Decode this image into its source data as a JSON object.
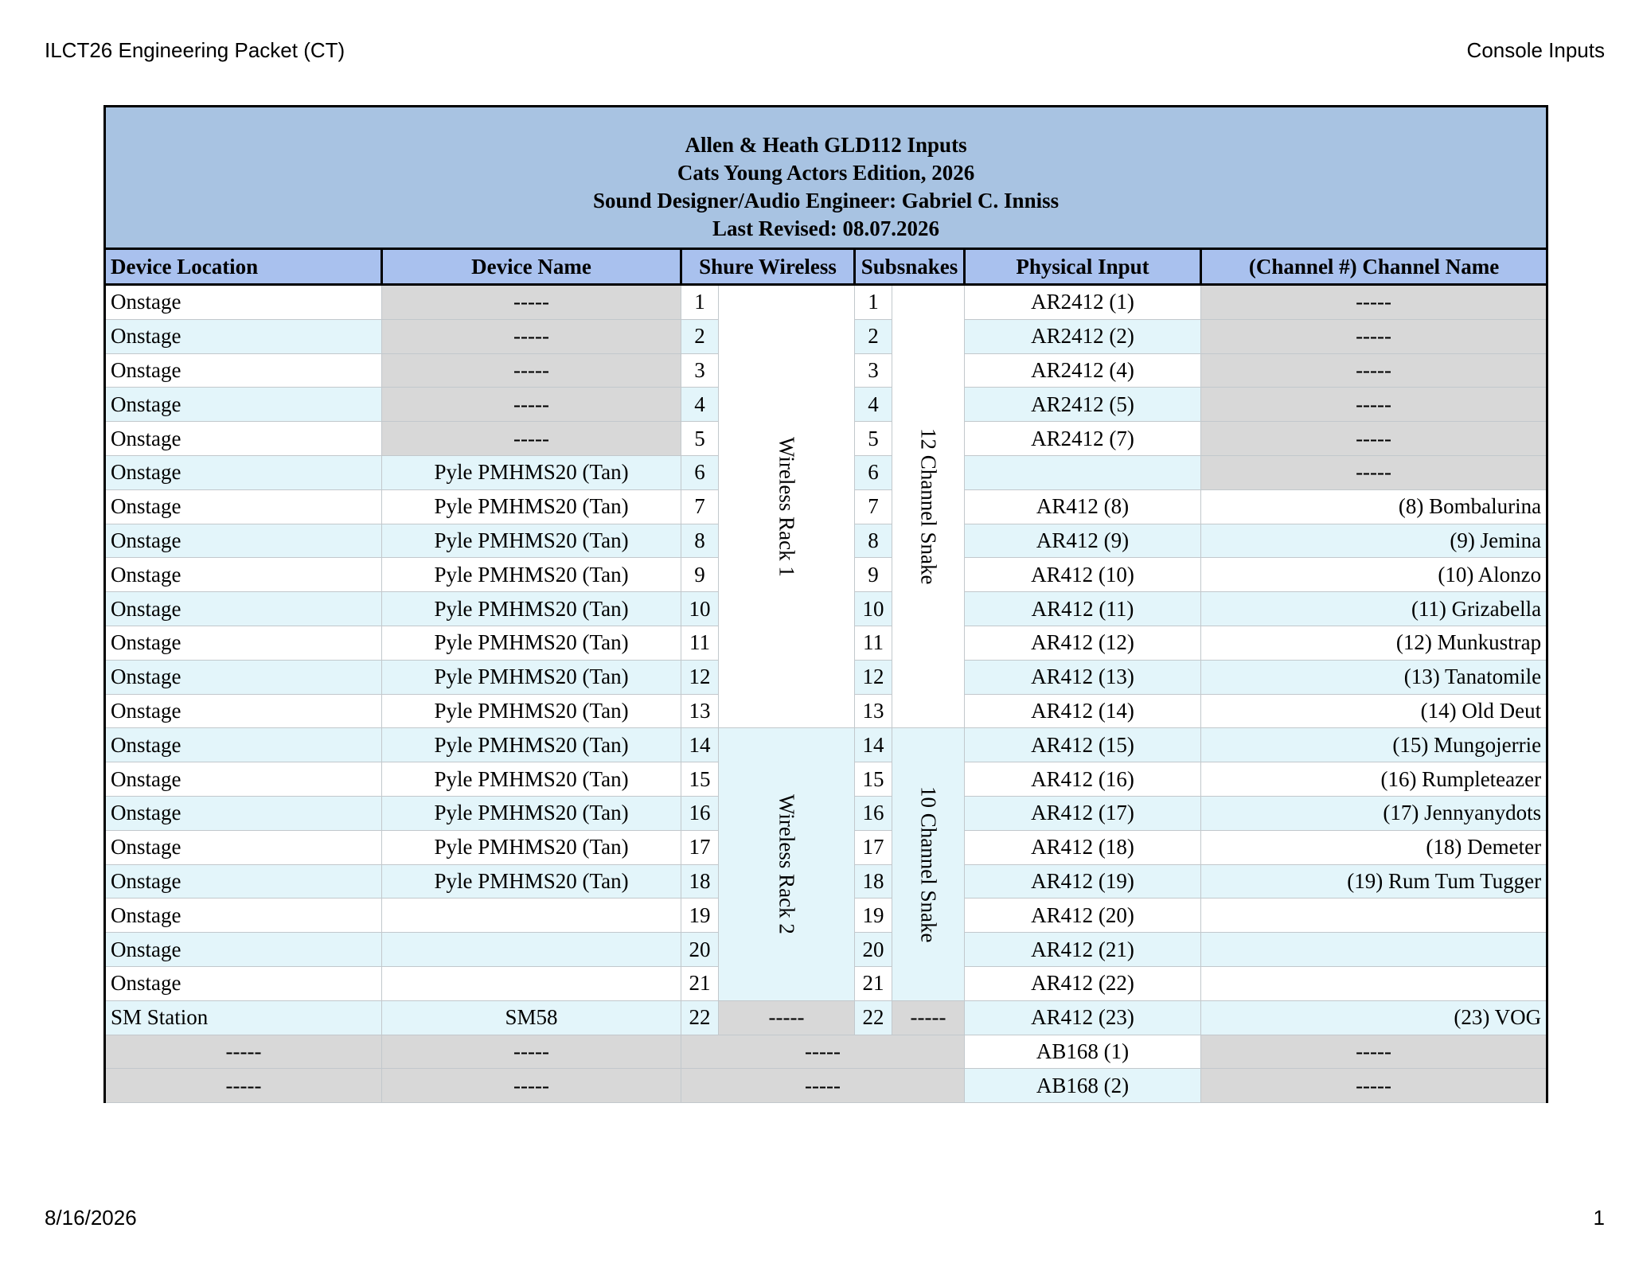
{
  "page_header": {
    "left": "ILCT26 Engineering Packet (CT)",
    "right": "Console Inputs"
  },
  "page_footer": {
    "left": "8/16/2026",
    "right": "1"
  },
  "title_block": {
    "line1": "Allen & Heath GLD112 Inputs",
    "line2": "Cats Young Actors Edition, 2026",
    "line3": "Sound Designer/Audio Engineer: Gabriel C. Inniss",
    "line4": "Last Revised: 08.07.2026"
  },
  "columns": [
    "Device Location",
    "Device Name",
    "Shure Wireless",
    "Subsnakes",
    "Physical Input",
    "(Channel #) Channel Name"
  ],
  "groups": {
    "wireless_rack_1": "Wireless Rack 1",
    "wireless_rack_2": "Wireless Rack 2",
    "snake_12": "12 Channel Snake",
    "snake_10": "10 Channel Snake",
    "sm_wireless": "-----",
    "sm_snake": "-----",
    "merged_blank": "-----"
  },
  "rows": [
    {
      "location": "Onstage",
      "device": "-----",
      "wireless": "1",
      "snake": "1",
      "input": "AR2412 (1)",
      "channel": "-----"
    },
    {
      "location": "Onstage",
      "device": "-----",
      "wireless": "2",
      "snake": "2",
      "input": "AR2412 (2)",
      "channel": "-----"
    },
    {
      "location": "Onstage",
      "device": "-----",
      "wireless": "3",
      "snake": "3",
      "input": "AR2412 (4)",
      "channel": "-----"
    },
    {
      "location": "Onstage",
      "device": "-----",
      "wireless": "4",
      "snake": "4",
      "input": "AR2412 (5)",
      "channel": "-----"
    },
    {
      "location": "Onstage",
      "device": "-----",
      "wireless": "5",
      "snake": "5",
      "input": "AR2412 (7)",
      "channel": "-----"
    },
    {
      "location": "Onstage",
      "device": "Pyle PMHMS20 (Tan)",
      "wireless": "6",
      "snake": "6",
      "input": "",
      "channel": "-----"
    },
    {
      "location": "Onstage",
      "device": "Pyle PMHMS20 (Tan)",
      "wireless": "7",
      "snake": "7",
      "input": "AR412 (8)",
      "channel": "(8) Bombalurina"
    },
    {
      "location": "Onstage",
      "device": "Pyle PMHMS20 (Tan)",
      "wireless": "8",
      "snake": "8",
      "input": "AR412 (9)",
      "channel": "(9) Jemina"
    },
    {
      "location": "Onstage",
      "device": "Pyle PMHMS20 (Tan)",
      "wireless": "9",
      "snake": "9",
      "input": "AR412 (10)",
      "channel": "(10) Alonzo"
    },
    {
      "location": "Onstage",
      "device": "Pyle PMHMS20 (Tan)",
      "wireless": "10",
      "snake": "10",
      "input": "AR412 (11)",
      "channel": "(11) Grizabella"
    },
    {
      "location": "Onstage",
      "device": "Pyle PMHMS20 (Tan)",
      "wireless": "11",
      "snake": "11",
      "input": "AR412 (12)",
      "channel": "(12) Munkustrap"
    },
    {
      "location": "Onstage",
      "device": "Pyle PMHMS20 (Tan)",
      "wireless": "12",
      "snake": "12",
      "input": "AR412 (13)",
      "channel": "(13) Tanatomile"
    },
    {
      "location": "Onstage",
      "device": "Pyle PMHMS20 (Tan)",
      "wireless": "13",
      "snake": "13",
      "input": "AR412 (14)",
      "channel": "(14) Old Deut"
    },
    {
      "location": "Onstage",
      "device": "Pyle PMHMS20 (Tan)",
      "wireless": "14",
      "snake": "14",
      "input": "AR412 (15)",
      "channel": "(15) Mungojerrie"
    },
    {
      "location": "Onstage",
      "device": "Pyle PMHMS20 (Tan)",
      "wireless": "15",
      "snake": "15",
      "input": "AR412 (16)",
      "channel": "(16) Rumpleteazer"
    },
    {
      "location": "Onstage",
      "device": "Pyle PMHMS20 (Tan)",
      "wireless": "16",
      "snake": "16",
      "input": "AR412 (17)",
      "channel": "(17) Jennyanydots"
    },
    {
      "location": "Onstage",
      "device": "Pyle PMHMS20 (Tan)",
      "wireless": "17",
      "snake": "17",
      "input": "AR412 (18)",
      "channel": "(18) Demeter"
    },
    {
      "location": "Onstage",
      "device": "Pyle PMHMS20 (Tan)",
      "wireless": "18",
      "snake": "18",
      "input": "AR412 (19)",
      "channel": "(19) Rum Tum Tugger"
    },
    {
      "location": "Onstage",
      "device": "",
      "wireless": "19",
      "snake": "19",
      "input": "AR412 (20)",
      "channel": ""
    },
    {
      "location": "Onstage",
      "device": "",
      "wireless": "20",
      "snake": "20",
      "input": "AR412 (21)",
      "channel": ""
    },
    {
      "location": "Onstage",
      "device": "",
      "wireless": "21",
      "snake": "21",
      "input": "AR412 (22)",
      "channel": ""
    },
    {
      "location": "SM Station",
      "device": "SM58",
      "wireless": "22",
      "snake": "22",
      "input": "AR412 (23)",
      "channel": "(23) VOG"
    },
    {
      "location": "-----",
      "device": "-----",
      "input": "AB168 (1)",
      "channel": "-----"
    },
    {
      "location": "-----",
      "device": "-----",
      "input": "AB168 (2)",
      "channel": "-----"
    }
  ]
}
